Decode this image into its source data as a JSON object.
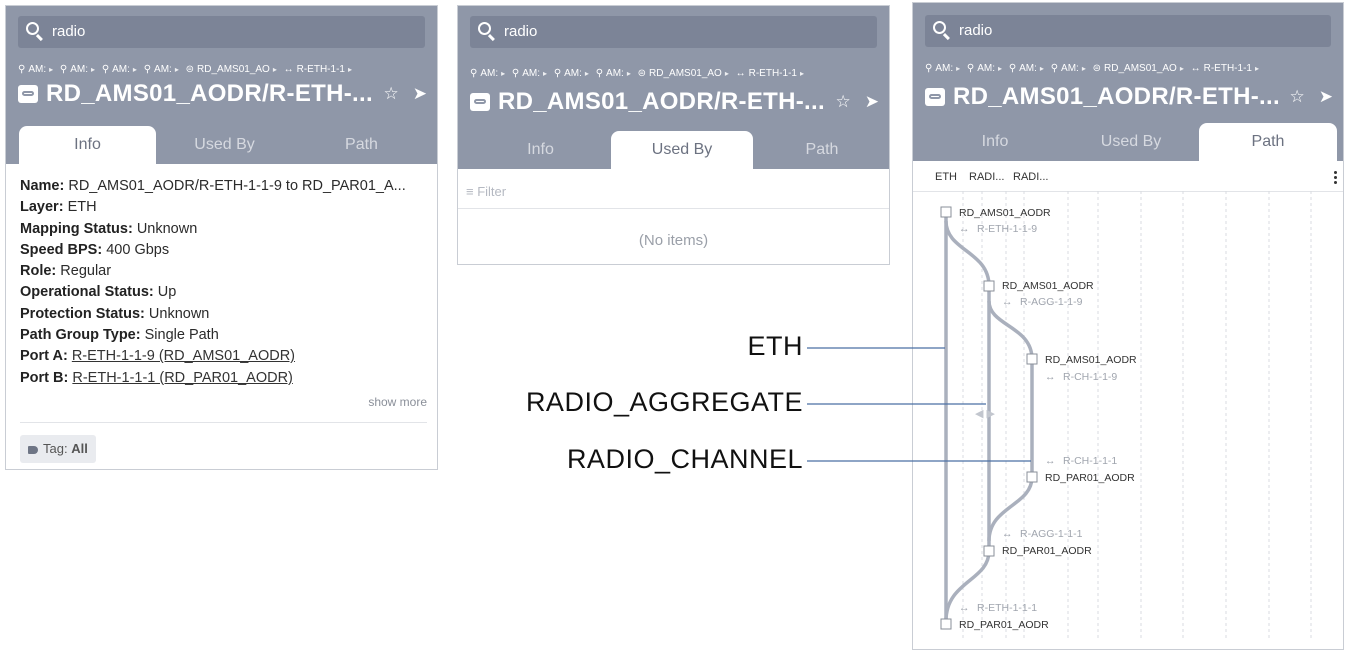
{
  "search": {
    "query": "radio"
  },
  "breadcrumbs": [
    {
      "icon": "location-pin-icon",
      "label": "AM:"
    },
    {
      "icon": "location-pin-icon",
      "label": "AM:"
    },
    {
      "icon": "location-pin-icon",
      "label": "AM:"
    },
    {
      "icon": "location-pin-icon",
      "label": "AM:"
    },
    {
      "icon": "device-icon",
      "label": "RD_AMS01_AO"
    },
    {
      "icon": "link-icon",
      "label": "R-ETH-1-1"
    }
  ],
  "header": {
    "title": "RD_AMS01_AODR/R-ETH-..."
  },
  "tabs": [
    "Info",
    "Used By",
    "Path"
  ],
  "info": {
    "rows": [
      {
        "label": "Name:",
        "value": "RD_AMS01_AODR/R-ETH-1-1-9 to RD_PAR01_A..."
      },
      {
        "label": "Layer:",
        "value": "ETH"
      },
      {
        "label": "Mapping Status:",
        "value": "Unknown"
      },
      {
        "label": "Speed BPS:",
        "value": "400 Gbps"
      },
      {
        "label": "Role:",
        "value": "Regular"
      },
      {
        "label": "Operational Status:",
        "value": "Up"
      },
      {
        "label": "Protection Status:",
        "value": "Unknown"
      },
      {
        "label": "Path Group Type:",
        "value": "Single Path"
      }
    ],
    "port_a_label": "Port A:",
    "port_a_value": "R-ETH-1-1-9 (RD_AMS01_AODR)",
    "port_b_label": "Port B:",
    "port_b_value": "R-ETH-1-1-1 (RD_PAR01_AODR)",
    "show_more": "show more",
    "tag_label": "Tag:",
    "tag_value": "All"
  },
  "used_by": {
    "filter_placeholder": "Filter",
    "empty_text": "(No items)"
  },
  "path": {
    "columns": [
      "ETH",
      "RADI...",
      "RADI..."
    ],
    "nodes": [
      {
        "device": "RD_AMS01_AODR",
        "port": "R-ETH-1-1-9"
      },
      {
        "device": "RD_AMS01_AODR",
        "port": "R-AGG-1-1-9"
      },
      {
        "device": "RD_AMS01_AODR",
        "port": "R-CH-1-1-9"
      },
      {
        "device": "RD_PAR01_AODR",
        "port": "R-CH-1-1-1"
      },
      {
        "device": "RD_PAR01_AODR",
        "port": "R-AGG-1-1-1"
      },
      {
        "device": "RD_PAR01_AODR",
        "port": "R-ETH-1-1-1"
      }
    ]
  },
  "callouts": [
    "ETH",
    "RADIO_AGGREGATE",
    "RADIO_CHANNEL"
  ],
  "colors": {
    "header_bg": "#8f97a8",
    "search_bg": "#7c8497",
    "path_line": "#aab0bd",
    "callout_line": "#4a6fa5"
  }
}
